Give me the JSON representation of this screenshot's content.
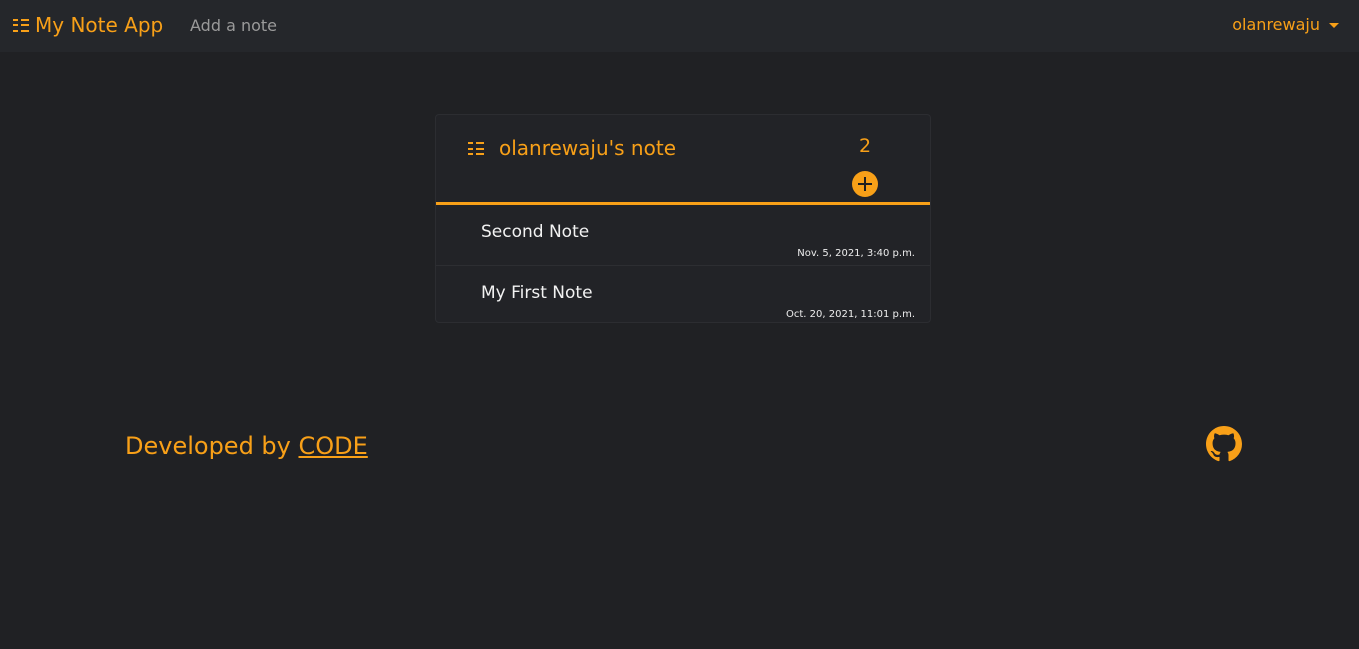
{
  "navbar": {
    "brand": "My Note App",
    "add_note_link": "Add a note",
    "user_menu": "olanrewaju"
  },
  "card": {
    "title": "olanrewaju's note",
    "count": "2",
    "notes": [
      {
        "title": "Second Note",
        "date": "Nov. 5, 2021, 3:40 p.m."
      },
      {
        "title": "My First Note",
        "date": "Oct. 20, 2021, 11:01 p.m."
      }
    ]
  },
  "footer": {
    "prefix": "Developed by ",
    "link": "CODE"
  },
  "icons": {
    "brand": "list-icon",
    "card": "list-icon",
    "add": "plus-circle-icon",
    "user_caret": "caret-down-icon",
    "github": "github-icon"
  },
  "colors": {
    "accent": "#f8a018",
    "background": "#202124",
    "navbar": "#25272b"
  }
}
